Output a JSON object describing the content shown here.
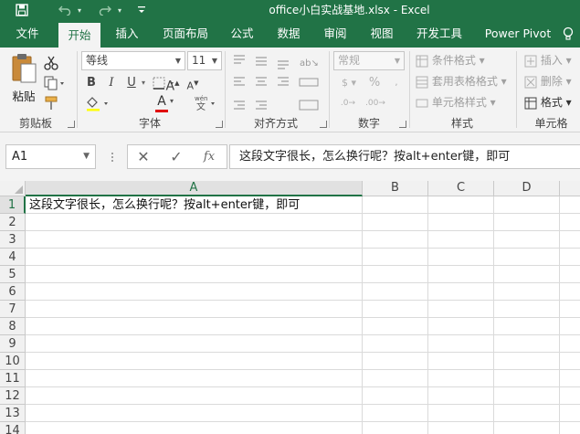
{
  "window": {
    "title": "office小白实战基地.xlsx - Excel"
  },
  "tabs": [
    {
      "label": "文件"
    },
    {
      "label": "开始"
    },
    {
      "label": "插入"
    },
    {
      "label": "页面布局"
    },
    {
      "label": "公式"
    },
    {
      "label": "数据"
    },
    {
      "label": "审阅"
    },
    {
      "label": "视图"
    },
    {
      "label": "开发工具"
    },
    {
      "label": "Power Pivot"
    }
  ],
  "active_tab": "开始",
  "ribbon": {
    "clipboard": {
      "paste_label": "粘贴",
      "group_label": "剪贴板"
    },
    "font": {
      "font_name": "等线",
      "font_size": "11",
      "bold": "B",
      "italic": "I",
      "underline": "U",
      "font_color_letter": "A",
      "font_color": "#e00000",
      "group_label": "字体"
    },
    "alignment": {
      "group_label": "对齐方式"
    },
    "number": {
      "format": "常规",
      "percent": "%",
      "group_label": "数字"
    },
    "styles": {
      "conditional": "条件格式",
      "table": "套用表格格式",
      "cell_styles": "单元格样式",
      "group_label": "样式"
    },
    "cells": {
      "insert": "插入",
      "delete": "删除",
      "format": "格式",
      "group_label": "单元格"
    }
  },
  "formula_bar": {
    "name_box": "A1",
    "fx": "fx",
    "content": "这段文字很长，怎么换行呢？按alt+enter键，即可"
  },
  "sheet": {
    "columns": [
      "A",
      "B",
      "C",
      "D"
    ],
    "rows": [
      "1",
      "2",
      "3",
      "4",
      "5",
      "6",
      "7",
      "8",
      "9",
      "10",
      "11",
      "12",
      "13",
      "14"
    ],
    "selected_cell": "A1",
    "cells": {
      "A1": "这段文字很长，怎么换行呢？按alt+enter键，即可"
    }
  },
  "colors": {
    "accent": "#217346",
    "ribbon_bg": "#f3f3f3"
  }
}
